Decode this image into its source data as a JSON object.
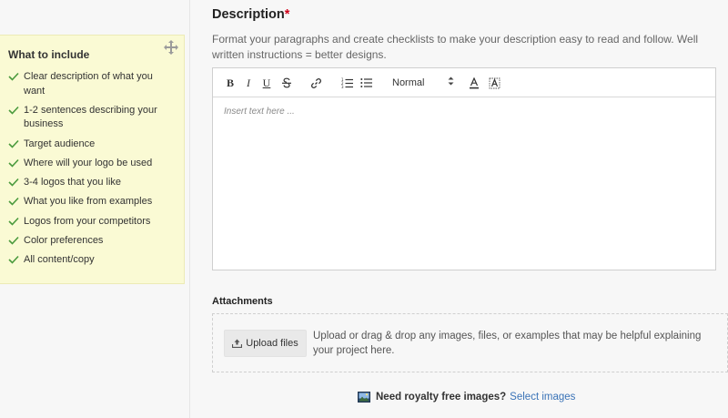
{
  "tips": {
    "title": "What to include",
    "items": [
      "Clear description of what you want",
      "1-2 sentences describing your business",
      "Target audience",
      "Where will your logo be used",
      "3-4 logos that you like",
      "What you like from examples",
      "Logos from your competitors",
      "Color preferences",
      "All content/copy"
    ]
  },
  "description": {
    "title": "Description",
    "required_mark": "*",
    "help": "Format your paragraphs and create checklists to make your description easy to read and follow. Well written instructions = better designs.",
    "placeholder": "Insert text here ...",
    "toolbar": {
      "bold": "B",
      "italic": "I",
      "underline": "U",
      "font_size": "Normal"
    }
  },
  "attachments": {
    "title": "Attachments",
    "upload_label": "Upload files",
    "drop_text": "Upload or drag & drop any images, files, or examples that may be helpful explaining your project here."
  },
  "royalty": {
    "label": "Need royalty free images?",
    "link": "Select images"
  },
  "colors": {
    "tips_bg": "#fafad4",
    "check": "#4a9a3d",
    "link": "#3a73b7",
    "required": "#d0021b"
  }
}
